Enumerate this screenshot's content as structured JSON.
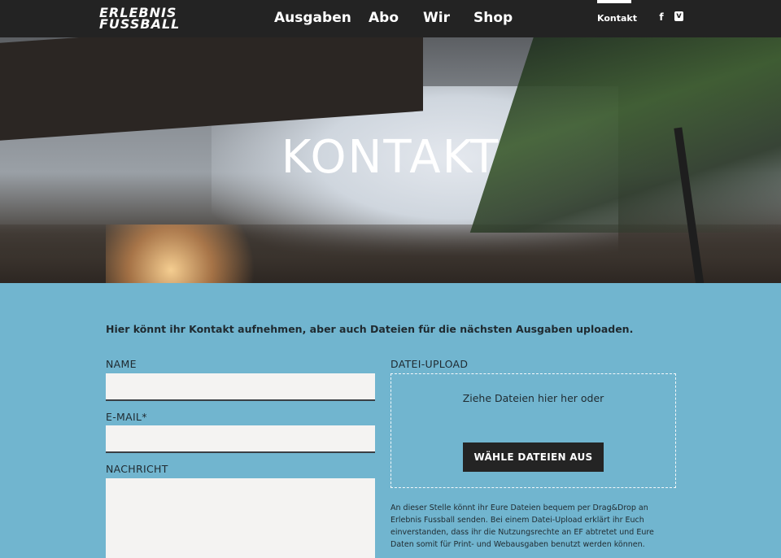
{
  "nav": {
    "logo_line1": "ERLEBNIS",
    "logo_line2": "FUSSBALL",
    "menu": [
      "Ausgaben",
      "Abo",
      "Wir",
      "Shop"
    ],
    "contact": "Kontakt",
    "social": [
      {
        "icon": "facebook-icon",
        "glyph": "f"
      },
      {
        "icon": "vimeo-icon",
        "glyph": "v"
      }
    ]
  },
  "hero": {
    "title": "KONTAKT"
  },
  "form": {
    "intro": "Hier könnt ihr Kontakt aufnehmen, aber auch Dateien für die nächsten Ausgaben uploaden.",
    "name_label": "NAME",
    "name_value": "",
    "email_label": "E-MAIL*",
    "email_value": "",
    "message_label": "NACHRICHT",
    "message_value": "",
    "upload_label": "DATEI-UPLOAD",
    "drop_text": "Ziehe Dateien hier her oder",
    "choose_button": "WÄHLE DATEIEN AUS",
    "upload_note": "An dieser Stelle könnt ihr Eure Dateien bequem per Drag&Drop an Erlebnis Fussball senden. Bei einem Datei-Upload erklärt ihr Euch einverstanden, dass ihr die Nutzungsrechte an EF abtretet und Eure Daten somit für Print- und Webausgaben benutzt werden können."
  },
  "colors": {
    "nav_bg": "#232323",
    "content_bg": "#71b5cf",
    "field_bg": "#f4f3f2",
    "button_bg": "#242424"
  }
}
